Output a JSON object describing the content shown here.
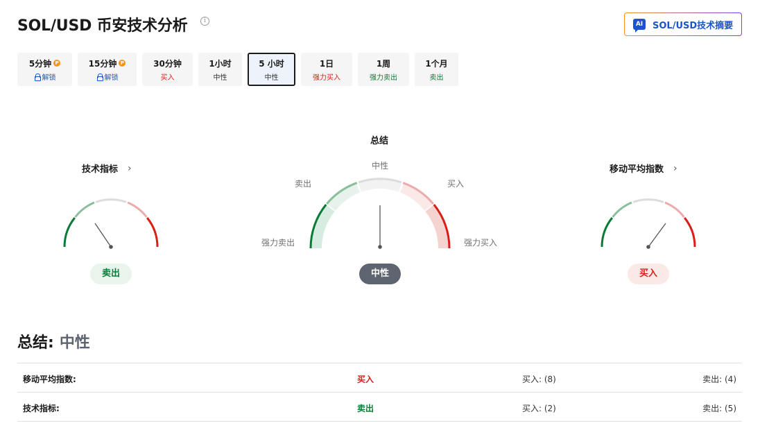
{
  "header": {
    "title": "SOL/USD 币安技术分析",
    "ai_button_label": "SOL/USD技术摘要",
    "ai_icon_text": "AI"
  },
  "tabs": [
    {
      "label": "5分钟",
      "status": "解锁",
      "locked": true
    },
    {
      "label": "15分钟",
      "status": "解锁",
      "locked": true
    },
    {
      "label": "30分钟",
      "status": "买入"
    },
    {
      "label": "1小时",
      "status": "中性"
    },
    {
      "label": "5 小时",
      "status": "中性",
      "active": true
    },
    {
      "label": "1日",
      "status": "强力买入"
    },
    {
      "label": "1周",
      "status": "强力卖出"
    },
    {
      "label": "1个月",
      "status": "卖出"
    }
  ],
  "gauges": {
    "technical": {
      "title": "技术指标",
      "signal": "卖出"
    },
    "summary": {
      "title": "总结",
      "signal": "中性",
      "labels": {
        "strong_sell": "强力卖出",
        "sell": "卖出",
        "neutral": "中性",
        "buy": "买入",
        "strong_buy": "强力买入"
      }
    },
    "moving_averages": {
      "title": "移动平均指数",
      "signal": "买入"
    }
  },
  "summary": {
    "label": "总结:",
    "value": "中性"
  },
  "table": [
    {
      "name": "移动平均指数:",
      "signal": "买入",
      "buy": "买入: (8)",
      "sell": "卖出: (4)"
    },
    {
      "name": "技术指标:",
      "signal": "卖出",
      "buy": "买入: (2)",
      "sell": "卖出: (5)"
    }
  ],
  "colors": {
    "buy": "#d91e18",
    "sell": "#0a7a37",
    "neutral": "#5e6470",
    "accent": "#1a56c9"
  }
}
